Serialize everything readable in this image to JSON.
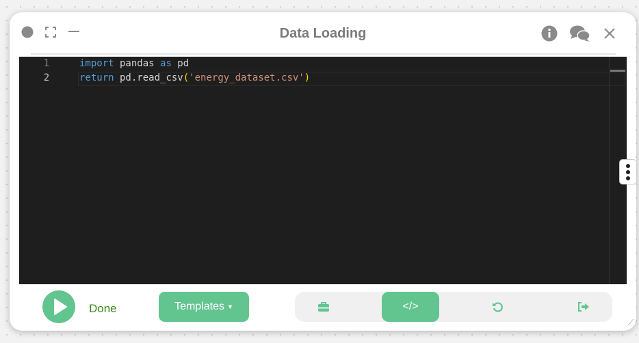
{
  "window": {
    "title": "Data Loading"
  },
  "editor": {
    "lines": [
      {
        "number": "1",
        "tokens": [
          "import",
          " pandas ",
          "as",
          " pd"
        ]
      },
      {
        "number": "2",
        "tokens": [
          "return",
          " pd.read_csv",
          "(",
          "'energy_dataset.csv'",
          ")"
        ]
      }
    ]
  },
  "footer": {
    "status": "Done",
    "templates_label": "Templates",
    "code_icon": "</>"
  },
  "colors": {
    "accent": "#62c48f",
    "status": "#3a8a1a"
  }
}
